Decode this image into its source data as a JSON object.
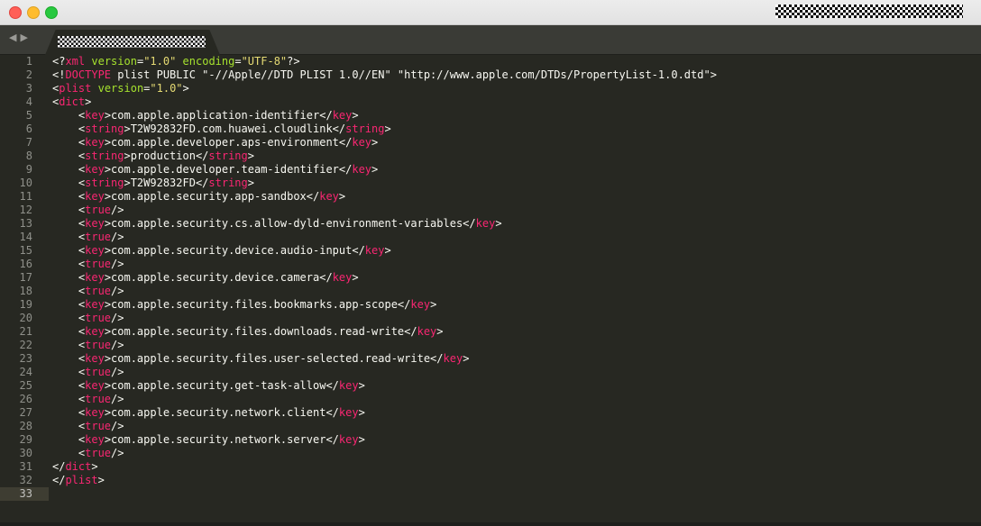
{
  "window": {
    "controls": [
      "close",
      "minimize",
      "zoom"
    ]
  },
  "tabbar": {
    "nav_back_icon": "◀",
    "nav_forward_icon": "▶"
  },
  "colors": {
    "background": "#272822",
    "tag": "#f92672",
    "attribute": "#a6e22e",
    "string": "#e6db74",
    "text": "#f8f8f2"
  },
  "editor": {
    "current_line": 33,
    "lines": [
      [
        {
          "c": "p",
          "t": "<?"
        },
        {
          "c": "t",
          "t": "xml"
        },
        {
          "c": "p",
          "t": " "
        },
        {
          "c": "a",
          "t": "version"
        },
        {
          "c": "p",
          "t": "="
        },
        {
          "c": "s",
          "t": "\"1.0\""
        },
        {
          "c": "p",
          "t": " "
        },
        {
          "c": "a",
          "t": "encoding"
        },
        {
          "c": "p",
          "t": "="
        },
        {
          "c": "s",
          "t": "\"UTF-8\""
        },
        {
          "c": "p",
          "t": "?>"
        }
      ],
      [
        {
          "c": "p",
          "t": "<!"
        },
        {
          "c": "t",
          "t": "DOCTYPE"
        },
        {
          "c": "p",
          "t": " plist PUBLIC \"-//Apple//DTD PLIST 1.0//EN\" \"http://www.apple.com/DTDs/PropertyList-1.0.dtd\">"
        }
      ],
      [
        {
          "c": "p",
          "t": "<"
        },
        {
          "c": "t",
          "t": "plist"
        },
        {
          "c": "p",
          "t": " "
        },
        {
          "c": "a",
          "t": "version"
        },
        {
          "c": "p",
          "t": "="
        },
        {
          "c": "s",
          "t": "\"1.0\""
        },
        {
          "c": "p",
          "t": ">"
        }
      ],
      [
        {
          "c": "p",
          "t": "<"
        },
        {
          "c": "t",
          "t": "dict"
        },
        {
          "c": "p",
          "t": ">"
        }
      ],
      [
        {
          "c": "p",
          "t": "    <"
        },
        {
          "c": "t",
          "t": "key"
        },
        {
          "c": "p",
          "t": ">com.apple.application-identifier</"
        },
        {
          "c": "t",
          "t": "key"
        },
        {
          "c": "p",
          "t": ">"
        }
      ],
      [
        {
          "c": "p",
          "t": "    <"
        },
        {
          "c": "t",
          "t": "string"
        },
        {
          "c": "p",
          "t": ">T2W92832FD.com.huawei.cloudlink</"
        },
        {
          "c": "t",
          "t": "string"
        },
        {
          "c": "p",
          "t": ">"
        }
      ],
      [
        {
          "c": "p",
          "t": "    <"
        },
        {
          "c": "t",
          "t": "key"
        },
        {
          "c": "p",
          "t": ">com.apple.developer.aps-environment</"
        },
        {
          "c": "t",
          "t": "key"
        },
        {
          "c": "p",
          "t": ">"
        }
      ],
      [
        {
          "c": "p",
          "t": "    <"
        },
        {
          "c": "t",
          "t": "string"
        },
        {
          "c": "p",
          "t": ">production</"
        },
        {
          "c": "t",
          "t": "string"
        },
        {
          "c": "p",
          "t": ">"
        }
      ],
      [
        {
          "c": "p",
          "t": "    <"
        },
        {
          "c": "t",
          "t": "key"
        },
        {
          "c": "p",
          "t": ">com.apple.developer.team-identifier</"
        },
        {
          "c": "t",
          "t": "key"
        },
        {
          "c": "p",
          "t": ">"
        }
      ],
      [
        {
          "c": "p",
          "t": "    <"
        },
        {
          "c": "t",
          "t": "string"
        },
        {
          "c": "p",
          "t": ">T2W92832FD</"
        },
        {
          "c": "t",
          "t": "string"
        },
        {
          "c": "p",
          "t": ">"
        }
      ],
      [
        {
          "c": "p",
          "t": "    <"
        },
        {
          "c": "t",
          "t": "key"
        },
        {
          "c": "p",
          "t": ">com.apple.security.app-sandbox</"
        },
        {
          "c": "t",
          "t": "key"
        },
        {
          "c": "p",
          "t": ">"
        }
      ],
      [
        {
          "c": "p",
          "t": "    <"
        },
        {
          "c": "t",
          "t": "true"
        },
        {
          "c": "p",
          "t": "/>"
        }
      ],
      [
        {
          "c": "p",
          "t": "    <"
        },
        {
          "c": "t",
          "t": "key"
        },
        {
          "c": "p",
          "t": ">com.apple.security.cs.allow-dyld-environment-variables</"
        },
        {
          "c": "t",
          "t": "key"
        },
        {
          "c": "p",
          "t": ">"
        }
      ],
      [
        {
          "c": "p",
          "t": "    <"
        },
        {
          "c": "t",
          "t": "true"
        },
        {
          "c": "p",
          "t": "/>"
        }
      ],
      [
        {
          "c": "p",
          "t": "    <"
        },
        {
          "c": "t",
          "t": "key"
        },
        {
          "c": "p",
          "t": ">com.apple.security.device.audio-input</"
        },
        {
          "c": "t",
          "t": "key"
        },
        {
          "c": "p",
          "t": ">"
        }
      ],
      [
        {
          "c": "p",
          "t": "    <"
        },
        {
          "c": "t",
          "t": "true"
        },
        {
          "c": "p",
          "t": "/>"
        }
      ],
      [
        {
          "c": "p",
          "t": "    <"
        },
        {
          "c": "t",
          "t": "key"
        },
        {
          "c": "p",
          "t": ">com.apple.security.device.camera</"
        },
        {
          "c": "t",
          "t": "key"
        },
        {
          "c": "p",
          "t": ">"
        }
      ],
      [
        {
          "c": "p",
          "t": "    <"
        },
        {
          "c": "t",
          "t": "true"
        },
        {
          "c": "p",
          "t": "/>"
        }
      ],
      [
        {
          "c": "p",
          "t": "    <"
        },
        {
          "c": "t",
          "t": "key"
        },
        {
          "c": "p",
          "t": ">com.apple.security.files.bookmarks.app-scope</"
        },
        {
          "c": "t",
          "t": "key"
        },
        {
          "c": "p",
          "t": ">"
        }
      ],
      [
        {
          "c": "p",
          "t": "    <"
        },
        {
          "c": "t",
          "t": "true"
        },
        {
          "c": "p",
          "t": "/>"
        }
      ],
      [
        {
          "c": "p",
          "t": "    <"
        },
        {
          "c": "t",
          "t": "key"
        },
        {
          "c": "p",
          "t": ">com.apple.security.files.downloads.read-write</"
        },
        {
          "c": "t",
          "t": "key"
        },
        {
          "c": "p",
          "t": ">"
        }
      ],
      [
        {
          "c": "p",
          "t": "    <"
        },
        {
          "c": "t",
          "t": "true"
        },
        {
          "c": "p",
          "t": "/>"
        }
      ],
      [
        {
          "c": "p",
          "t": "    <"
        },
        {
          "c": "t",
          "t": "key"
        },
        {
          "c": "p",
          "t": ">com.apple.security.files.user-selected.read-write</"
        },
        {
          "c": "t",
          "t": "key"
        },
        {
          "c": "p",
          "t": ">"
        }
      ],
      [
        {
          "c": "p",
          "t": "    <"
        },
        {
          "c": "t",
          "t": "true"
        },
        {
          "c": "p",
          "t": "/>"
        }
      ],
      [
        {
          "c": "p",
          "t": "    <"
        },
        {
          "c": "t",
          "t": "key"
        },
        {
          "c": "p",
          "t": ">com.apple.security.get-task-allow</"
        },
        {
          "c": "t",
          "t": "key"
        },
        {
          "c": "p",
          "t": ">"
        }
      ],
      [
        {
          "c": "p",
          "t": "    <"
        },
        {
          "c": "t",
          "t": "true"
        },
        {
          "c": "p",
          "t": "/>"
        }
      ],
      [
        {
          "c": "p",
          "t": "    <"
        },
        {
          "c": "t",
          "t": "key"
        },
        {
          "c": "p",
          "t": ">com.apple.security.network.client</"
        },
        {
          "c": "t",
          "t": "key"
        },
        {
          "c": "p",
          "t": ">"
        }
      ],
      [
        {
          "c": "p",
          "t": "    <"
        },
        {
          "c": "t",
          "t": "true"
        },
        {
          "c": "p",
          "t": "/>"
        }
      ],
      [
        {
          "c": "p",
          "t": "    <"
        },
        {
          "c": "t",
          "t": "key"
        },
        {
          "c": "p",
          "t": ">com.apple.security.network.server</"
        },
        {
          "c": "t",
          "t": "key"
        },
        {
          "c": "p",
          "t": ">"
        }
      ],
      [
        {
          "c": "p",
          "t": "    <"
        },
        {
          "c": "t",
          "t": "true"
        },
        {
          "c": "p",
          "t": "/>"
        }
      ],
      [
        {
          "c": "p",
          "t": "</"
        },
        {
          "c": "t",
          "t": "dict"
        },
        {
          "c": "p",
          "t": ">"
        }
      ],
      [
        {
          "c": "p",
          "t": "</"
        },
        {
          "c": "t",
          "t": "plist"
        },
        {
          "c": "p",
          "t": ">"
        }
      ],
      []
    ]
  }
}
